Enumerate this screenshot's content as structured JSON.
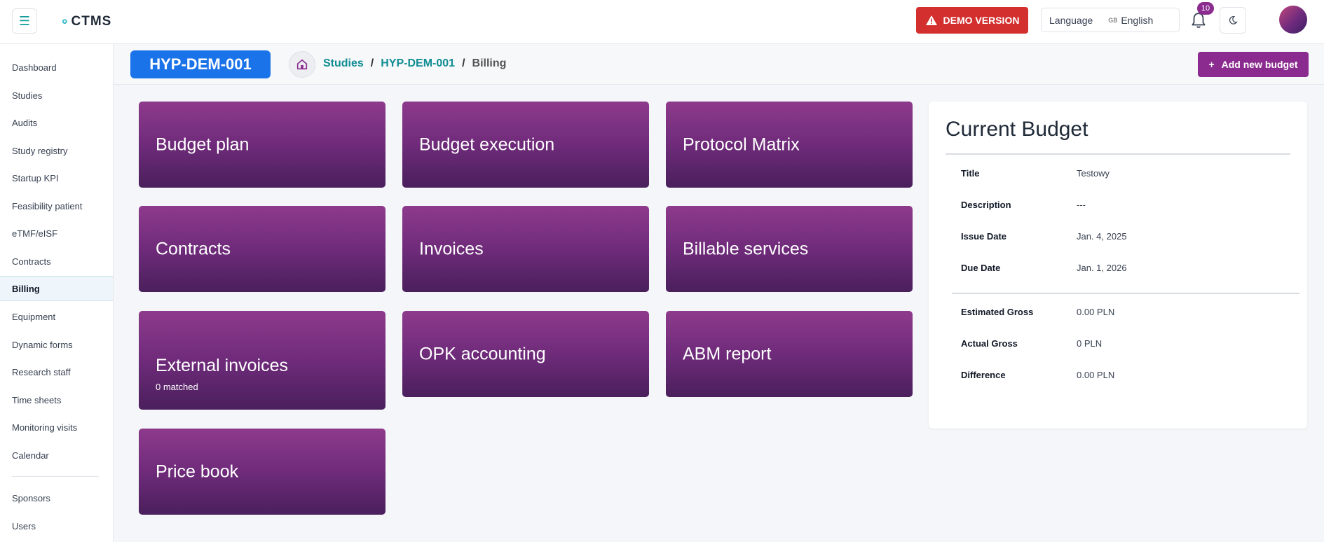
{
  "header": {
    "logo": "CTMS",
    "demo_label": "DEMO VERSION",
    "language_label": "Language",
    "language_flag": "GB",
    "language_value": "English",
    "notification_count": "10"
  },
  "sidebar": {
    "items": [
      {
        "label": "Dashboard"
      },
      {
        "label": "Studies"
      },
      {
        "label": "Audits"
      },
      {
        "label": "Study registry"
      },
      {
        "label": "Startup KPI"
      },
      {
        "label": "Feasibility patient"
      },
      {
        "label": "eTMF/eISF"
      },
      {
        "label": "Contracts"
      },
      {
        "label": "Billing",
        "active": true
      },
      {
        "label": "Equipment"
      },
      {
        "label": "Dynamic forms"
      },
      {
        "label": "Research staff"
      },
      {
        "label": "Time sheets"
      },
      {
        "label": "Monitoring visits"
      },
      {
        "label": "Calendar"
      },
      {
        "label": "Sponsors"
      },
      {
        "label": "Users"
      }
    ]
  },
  "subheader": {
    "study_code": "HYP-DEM-001",
    "breadcrumb": [
      "Studies",
      "HYP-DEM-001",
      "Billing"
    ],
    "add_button": "Add new budget"
  },
  "tiles": [
    {
      "title": "Budget plan"
    },
    {
      "title": "Budget execution"
    },
    {
      "title": "Protocol Matrix"
    },
    {
      "title": "Contracts"
    },
    {
      "title": "Invoices"
    },
    {
      "title": "Billable services"
    },
    {
      "title": "External invoices",
      "subtitle": "0 matched"
    },
    {
      "title": "OPK accounting"
    },
    {
      "title": "ABM report"
    },
    {
      "title": "Price book"
    }
  ],
  "budget": {
    "title": "Current Budget",
    "rows": [
      {
        "label": "Title",
        "value": "Testowy"
      },
      {
        "label": "Description",
        "value": "---"
      },
      {
        "label": "Issue Date",
        "value": "Jan. 4, 2025"
      },
      {
        "label": "Due Date",
        "value": "Jan. 1, 2026"
      },
      {
        "label": "Estimated Gross",
        "value": "0.00 PLN"
      },
      {
        "label": "Actual Gross",
        "value": "0 PLN"
      },
      {
        "label": "Difference",
        "value": "0.00 PLN"
      }
    ]
  },
  "colors": {
    "accent": "#8b2b8f",
    "primary": "#1a73e8",
    "demo": "#d32f2f",
    "link": "#0f8d93"
  }
}
